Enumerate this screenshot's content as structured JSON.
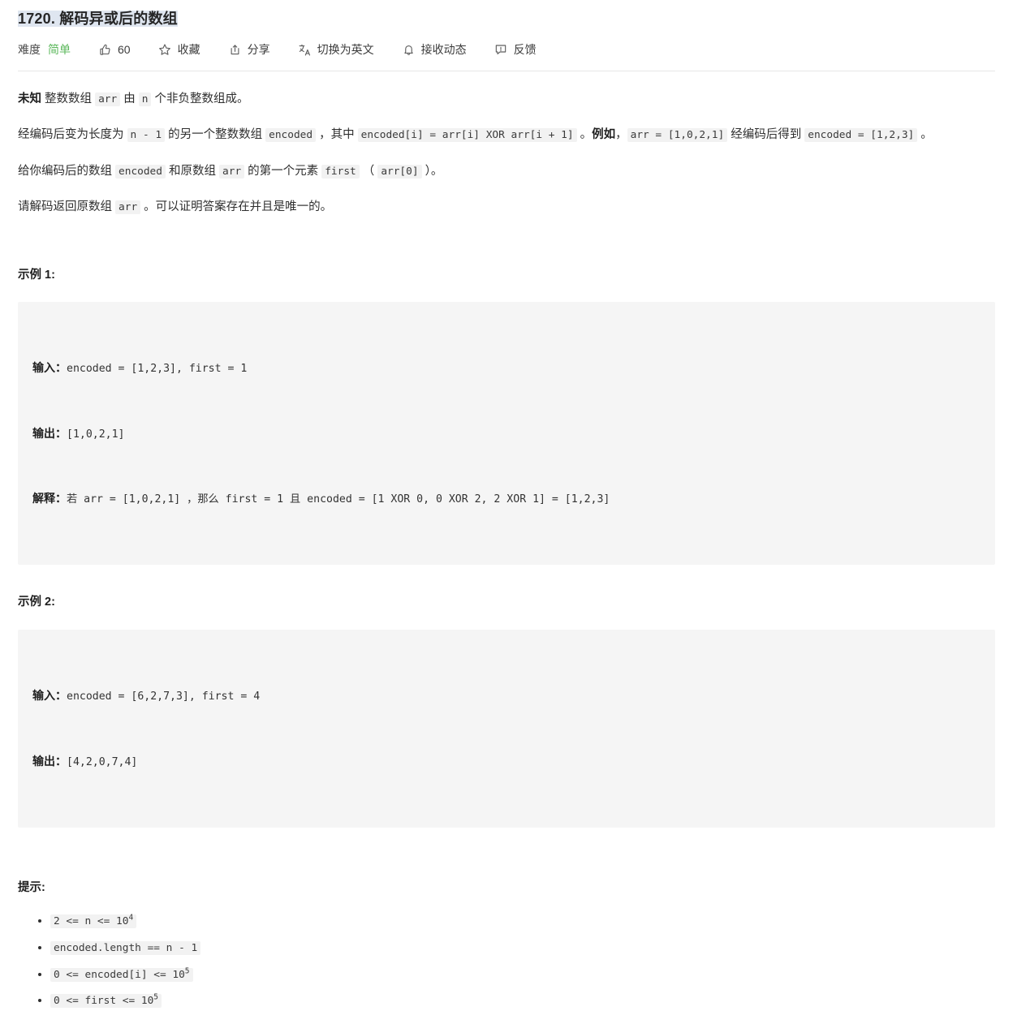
{
  "problem": {
    "title": "1720. 解码异或后的数组"
  },
  "meta": {
    "difficulty_label": "难度",
    "difficulty_value": "简单",
    "likes_count": "60",
    "favorite_label": "收藏",
    "share_label": "分享",
    "translate_label": "切换为英文",
    "subscribe_label": "接收动态",
    "feedback_label": "反馈",
    "difficulty_color": "#5cb85c"
  },
  "description": {
    "p1": {
      "bold_prefix": "未知",
      "t1": " 整数数组 ",
      "c1": "arr",
      "t2": " 由 ",
      "c2": "n",
      "t3": " 个非负整数组成。"
    },
    "p2": {
      "t1": "经编码后变为长度为 ",
      "c1": "n - 1",
      "t2": " 的另一个整数数组 ",
      "c2": "encoded",
      "t3": " ，其中 ",
      "c3": "encoded[i] = arr[i] XOR arr[i + 1]",
      "t4": " 。",
      "bold1": "例如",
      "t5": "，",
      "c4": "arr = [1,0,2,1]",
      "t6": " 经编码后得到 ",
      "c5": "encoded = [1,2,3]",
      "t7": " 。"
    },
    "p3": {
      "t1": "给你编码后的数组 ",
      "c1": "encoded",
      "t2": " 和原数组 ",
      "c2": "arr",
      "t3": " 的第一个元素 ",
      "c3": "first",
      "t4": " （ ",
      "c4": "arr[0]",
      "t5": " ）。"
    },
    "p4": {
      "t1": "请解码返回原数组 ",
      "c1": "arr",
      "t2": " 。可以证明答案存在并且是唯一的。"
    }
  },
  "examples": [
    {
      "heading": "示例 1:",
      "input_label": "输入：",
      "input_value": "encoded = [1,2,3], first = 1",
      "output_label": "输出：",
      "output_value": "[1,0,2,1]",
      "explain_label": "解释：",
      "explain_value": "若 arr = [1,0,2,1] ，那么 first = 1 且 encoded = [1 XOR 0, 0 XOR 2, 2 XOR 1] = [1,2,3]"
    },
    {
      "heading": "示例 2:",
      "input_label": "输入：",
      "input_value": "encoded = [6,2,7,3], first = 4",
      "output_label": "输出：",
      "output_value": "[4,2,0,7,4]",
      "explain_label": "",
      "explain_value": ""
    }
  ],
  "hints": {
    "heading": "提示:",
    "items": [
      {
        "base": "2 <= n <= 10",
        "sup": "4"
      },
      {
        "base": "encoded.length == n - 1",
        "sup": ""
      },
      {
        "base": "0 <= encoded[i] <= 10",
        "sup": "5"
      },
      {
        "base": "0 <= first <= 10",
        "sup": "5"
      }
    ]
  }
}
